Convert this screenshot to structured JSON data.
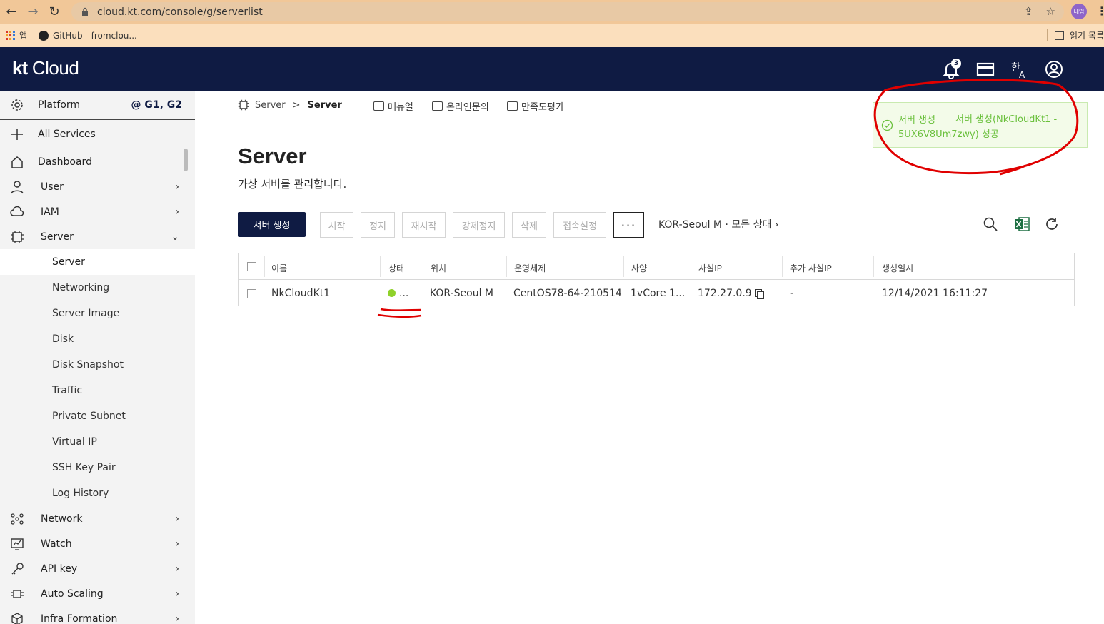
{
  "browser": {
    "url": "cloud.kt.com/console/g/serverlist",
    "avatar_text": "네임",
    "bookmarks": [
      {
        "label": "앱",
        "icon": "apps-icon"
      },
      {
        "label": "GitHub - fromclou...",
        "icon": "github-icon"
      }
    ],
    "reading_list": "읽기 목록"
  },
  "app": {
    "logo_kt": "kt",
    "logo_cloud": "Cloud",
    "notification_count": "3"
  },
  "sidebar": {
    "platform_label": "Platform",
    "platform_gen": "@ G1, G2",
    "all_services": "All Services",
    "items": [
      {
        "label": "Dashboard"
      },
      {
        "label": "User"
      },
      {
        "label": "IAM"
      },
      {
        "label": "Server",
        "expanded": true
      }
    ],
    "server_sub": [
      "Server",
      "Networking",
      "Server Image",
      "Disk",
      "Disk Snapshot",
      "Traffic",
      "Private Subnet",
      "Virtual IP",
      "SSH Key Pair",
      "Log History"
    ],
    "bottom_items": [
      "Network",
      "Watch",
      "API key",
      "Auto Scaling",
      "Infra Formation"
    ]
  },
  "main": {
    "breadcrumb": {
      "root": "Server",
      "sep": ">",
      "current": "Server"
    },
    "links": {
      "manual": "매뉴얼",
      "inquiry": "온라인문의",
      "survey": "만족도평가"
    },
    "title": "Server",
    "subtitle": "가상 서버를 관리합니다.",
    "buttons": {
      "create": "서버 생성",
      "start": "시작",
      "stop": "정지",
      "restart": "재시작",
      "force_stop": "강제정지",
      "delete": "삭제",
      "access": "접속설정",
      "more": "···"
    },
    "filter": "KOR-Seoul M · 모든 상태 ›"
  },
  "table": {
    "headers": [
      "이름",
      "상태",
      "위치",
      "운영체제",
      "사양",
      "사설IP",
      "추가 사설IP",
      "생성일시"
    ],
    "rows": [
      {
        "name": "NkCloudKt1",
        "status": "...",
        "location": "KOR-Seoul M",
        "os": "CentOS78-64-210514",
        "spec": "1vCore 1...",
        "private_ip": "172.27.0.9",
        "extra_ip": "-",
        "created": "12/14/2021 16:11:27"
      }
    ]
  },
  "toast": {
    "title": "서버 생성",
    "message": "서버 생성(NkCloudKt1 - 5UX6V8Um7zwy) 성공"
  },
  "colors": {
    "header_bg": "#0f1b43",
    "toast_text": "#6ac03c",
    "status_running": "#8fd12a",
    "annotation": "#e00000"
  }
}
